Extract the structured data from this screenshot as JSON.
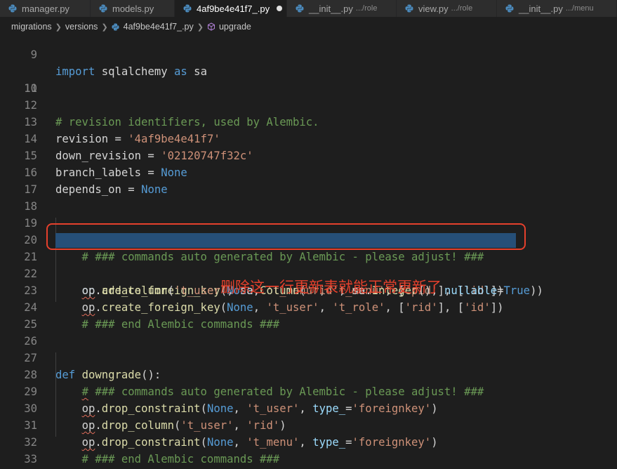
{
  "tabs": [
    {
      "name": "manager.py",
      "desc": "",
      "active": false,
      "dirty": false
    },
    {
      "name": "models.py",
      "desc": "",
      "active": false,
      "dirty": false
    },
    {
      "name": "4af9be4e41f7_.py",
      "desc": "",
      "active": true,
      "dirty": true
    },
    {
      "name": "__init__.py",
      "desc": ".../role",
      "active": false,
      "dirty": false
    },
    {
      "name": "view.py",
      "desc": ".../role",
      "active": false,
      "dirty": false
    },
    {
      "name": "__init__.py",
      "desc": ".../menu",
      "active": false,
      "dirty": false
    }
  ],
  "breadcrumb": {
    "items": [
      "migrations",
      "versions",
      "4af9be4e41f7_.py",
      "upgrade"
    ]
  },
  "editor": {
    "line_numbers": [
      "9",
      "10",
      "11",
      "12",
      "13",
      "14",
      "15",
      "16",
      "17",
      "18",
      "19",
      "20",
      "21",
      "22",
      "23",
      "24",
      "25",
      "26",
      "27",
      "28",
      "29",
      "30",
      "31",
      "32",
      "33"
    ]
  },
  "annotation": {
    "text": "删除这一行更新表就能正常更新了",
    "color": "#e5402c"
  },
  "colors": {
    "background": "#1e1e1e",
    "selection": "#264f78",
    "keyword": "#569cd6",
    "string": "#ce9178",
    "comment": "#6a9955",
    "function": "#dcdcaa"
  },
  "icons": [
    "python-file-icon",
    "method-cube-icon",
    "chevron-right-icon",
    "unsaved-dot-icon"
  ]
}
